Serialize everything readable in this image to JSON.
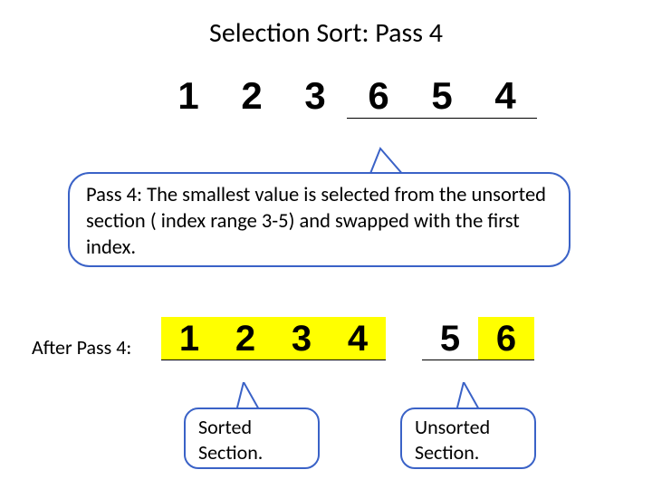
{
  "title": "Selection Sort: Pass 4",
  "top_row": [
    "1",
    "2",
    "3",
    "6",
    "5",
    "4"
  ],
  "bubble_main": "Pass 4: The smallest value is selected from the unsorted section ( index range 3-5) and swapped with the first index.",
  "after_label": "After Pass 4:",
  "after_row": {
    "sorted": [
      "1",
      "2",
      "3",
      "4"
    ],
    "unsorted": [
      "5",
      "6"
    ]
  },
  "bubble_sorted": "Sorted Section.",
  "bubble_unsorted": "Unsorted Section."
}
